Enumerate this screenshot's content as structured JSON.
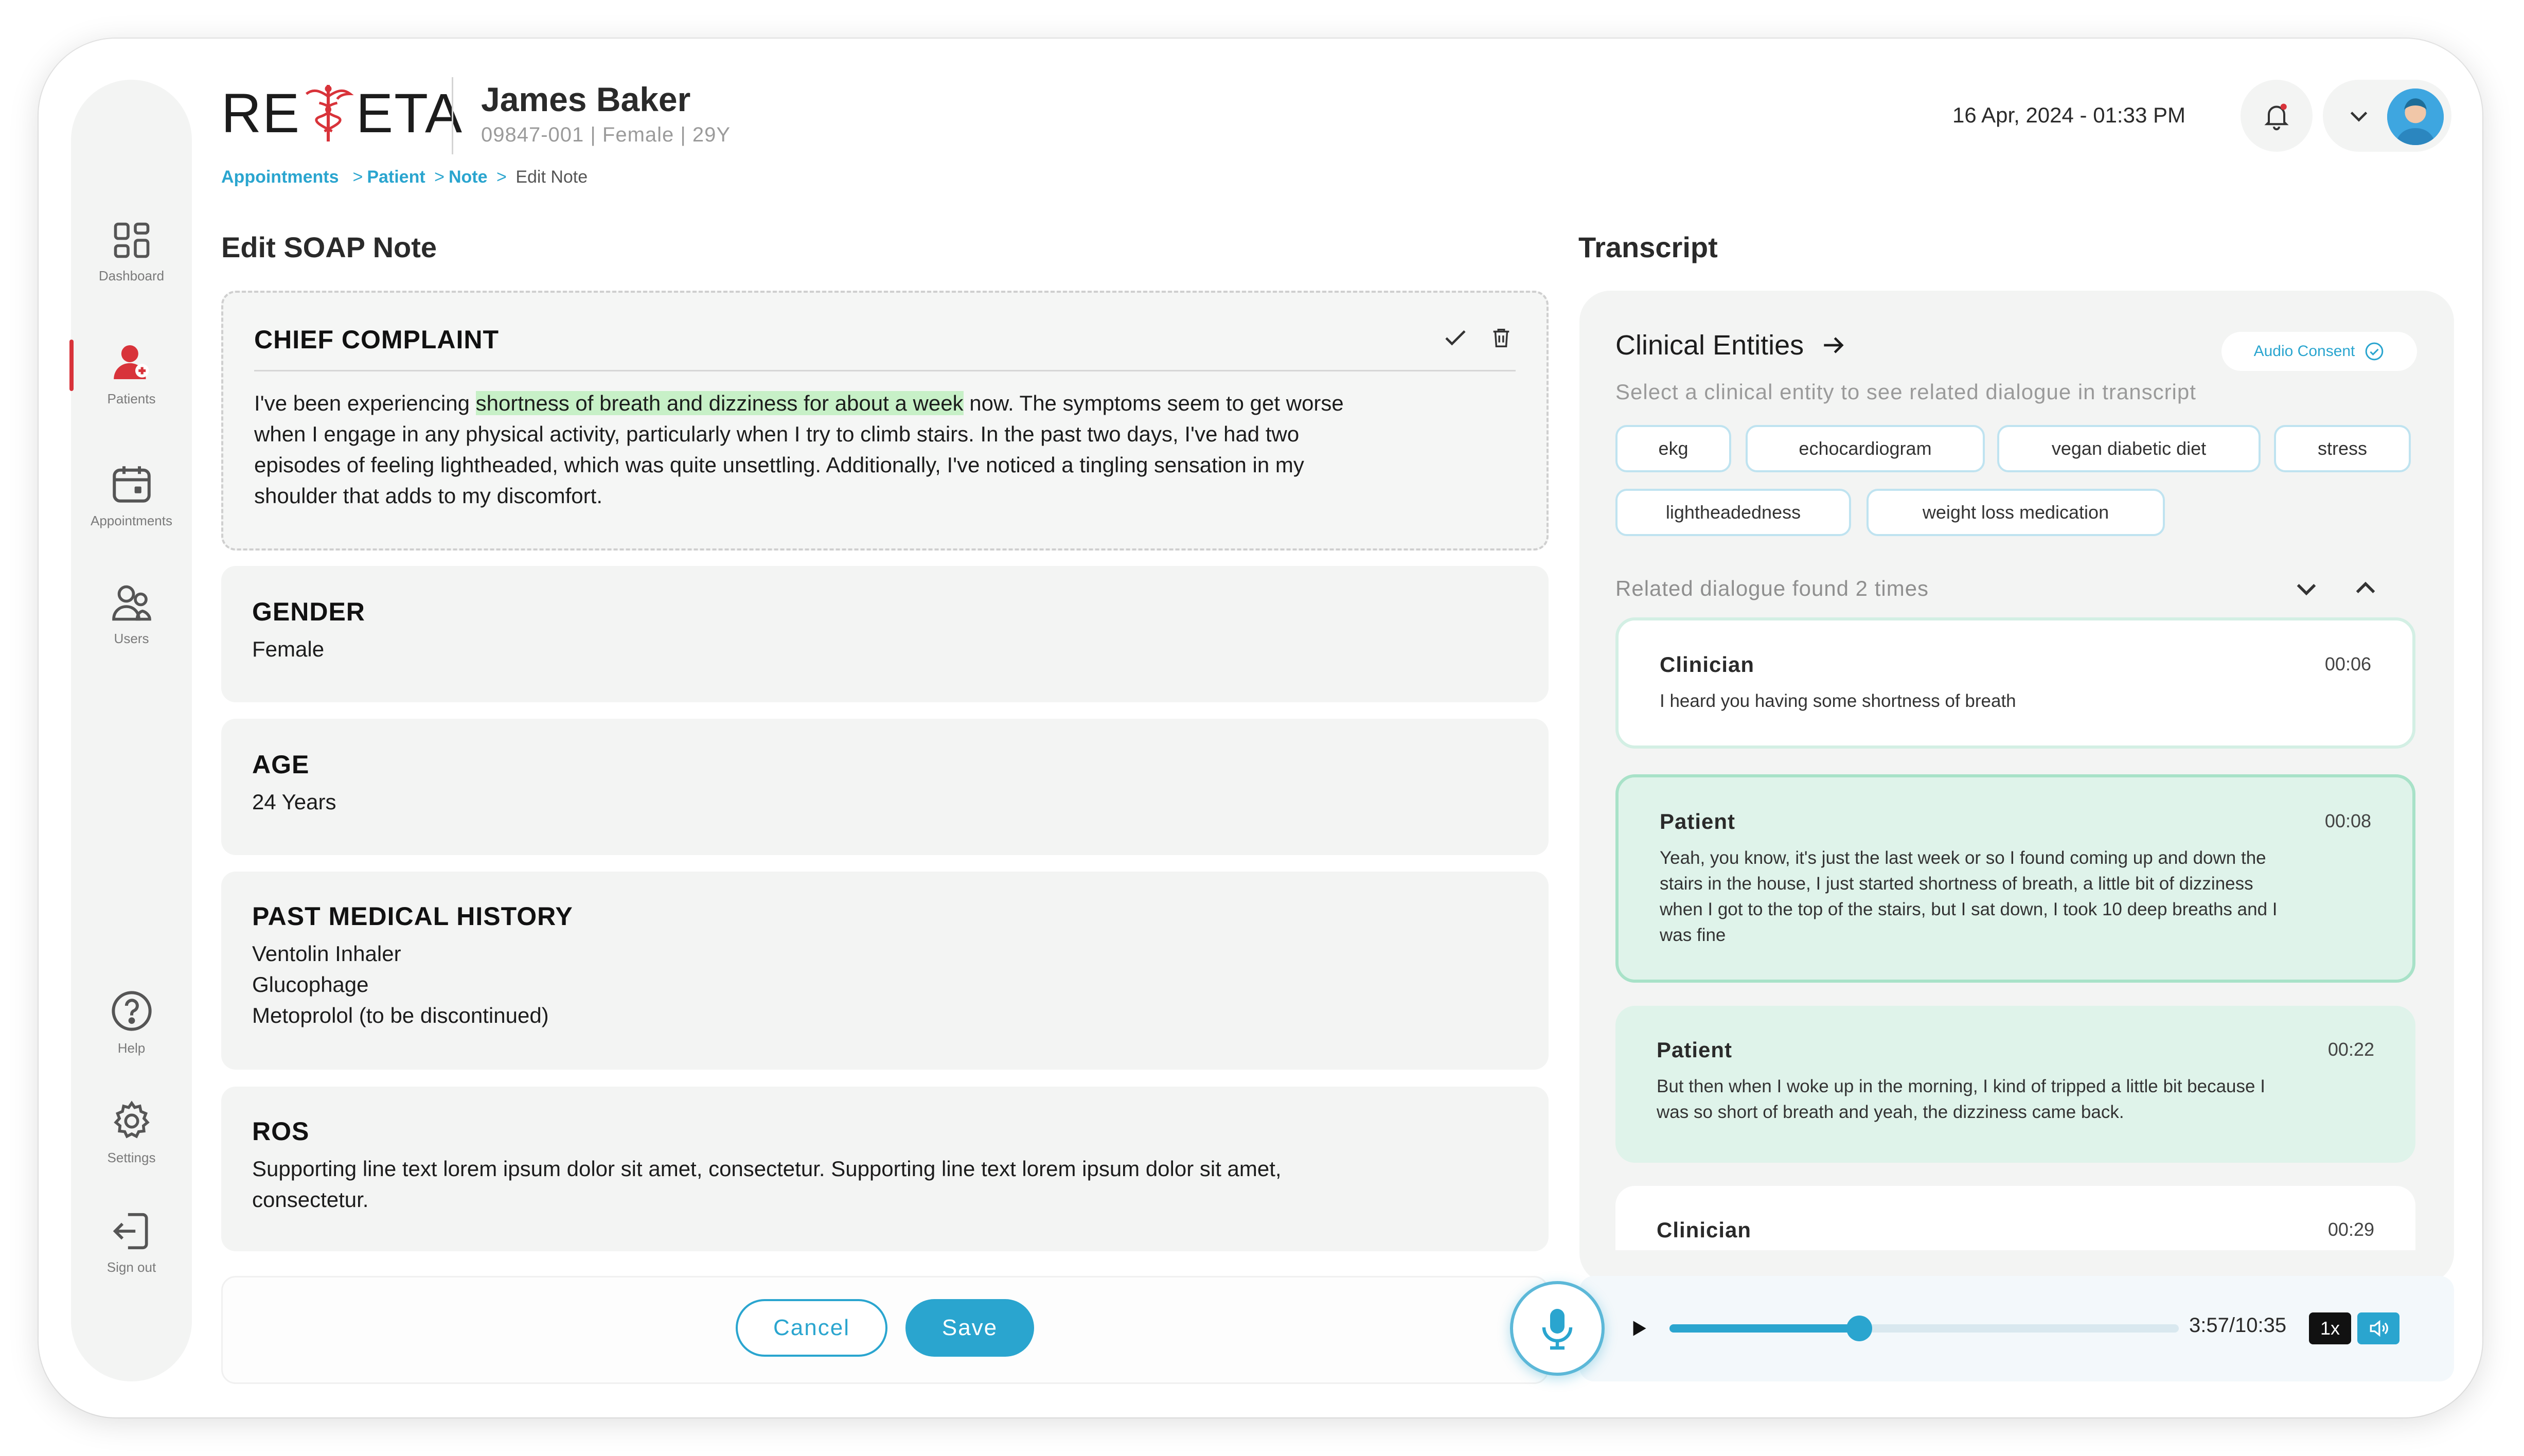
{
  "app": {
    "logo_text_left": "RE",
    "logo_text_right": "ETA",
    "brand_color": "#2aa5cf",
    "accent_red": "#d8333a"
  },
  "header": {
    "patient_name": "James Baker",
    "patient_meta": "09847-001 | Female | 29Y",
    "datetime": "16 Apr, 2024 - 01:33 PM"
  },
  "breadcrumb": {
    "items": [
      "Appointments",
      "Patient",
      "Note"
    ],
    "current": "Edit Note"
  },
  "sidebar": {
    "items": [
      {
        "label": "Dashboard",
        "icon": "dashboard-icon",
        "active": false
      },
      {
        "label": "Patients",
        "icon": "patient-icon",
        "active": true
      },
      {
        "label": "Appointments",
        "icon": "calendar-icon",
        "active": false
      },
      {
        "label": "Users",
        "icon": "users-icon",
        "active": false
      }
    ],
    "bottom_items": [
      {
        "label": "Help",
        "icon": "help-icon"
      },
      {
        "label": "Settings",
        "icon": "gear-icon"
      },
      {
        "label": "Sign out",
        "icon": "sign-out-icon"
      }
    ]
  },
  "soap": {
    "title": "Edit SOAP Note",
    "chief_complaint": {
      "title": "CHIEF COMPLAINT",
      "before": "I've been experiencing ",
      "highlight": "shortness of breath and dizziness for about a week",
      "line1_after": " now. The symptoms seem to get worse",
      "line2": "when I engage in any physical activity, particularly when I try to climb stairs. In the past two days, I've had two",
      "line3": "episodes of feeling lightheaded, which was quite unsettling. Additionally, I've noticed a tingling sensation in my",
      "line4": "shoulder that adds to my discomfort."
    },
    "gender": {
      "title": "GENDER",
      "value": "Female"
    },
    "age": {
      "title": "AGE",
      "value": "24 Years"
    },
    "pmh": {
      "title": "PAST MEDICAL HISTORY",
      "items": [
        "Ventolin Inhaler",
        "Glucophage",
        "Metoprolol (to be discontinued)"
      ]
    },
    "ros": {
      "title": "ROS",
      "line1": "Supporting line text lorem ipsum dolor sit amet, consectetur. Supporting line text lorem ipsum dolor sit amet,",
      "line2": "consectetur."
    },
    "cancel_label": "Cancel",
    "save_label": "Save"
  },
  "transcript": {
    "title": "Transcript",
    "entities_title": "Clinical Entities",
    "audio_consent": "Audio Consent",
    "entities_hint": "Select a clinical entity to see related dialogue in transcript",
    "chips": [
      "ekg",
      "echocardiogram",
      "vegan diabetic diet",
      "stress",
      "lightheadedness",
      "weight loss medication"
    ],
    "related_text": "Related dialogue found 2 times",
    "dialogues": [
      {
        "speaker": "Clinician",
        "time": "00:06",
        "lines": [
          "I heard you having some shortness of breath"
        ]
      },
      {
        "speaker": "Patient",
        "time": "00:08",
        "lines": [
          "Yeah, you know, it's just the last week or so I found coming up and down the",
          "stairs in the house, I just started shortness of breath, a little bit of dizziness",
          "when I got to the top of the stairs, but I sat down, I took 10 deep breaths and I",
          "was fine"
        ]
      },
      {
        "speaker": "Patient",
        "time": "00:22",
        "lines": [
          "But then when I woke up in the morning, I kind of tripped a little bit because I",
          "was so short of breath and yeah, the dizziness came back."
        ]
      },
      {
        "speaker": "Clinician",
        "time": "00:29",
        "lines": []
      }
    ]
  },
  "player": {
    "time": "3:57/10:35",
    "progress": 0.373,
    "speed": "1x"
  }
}
